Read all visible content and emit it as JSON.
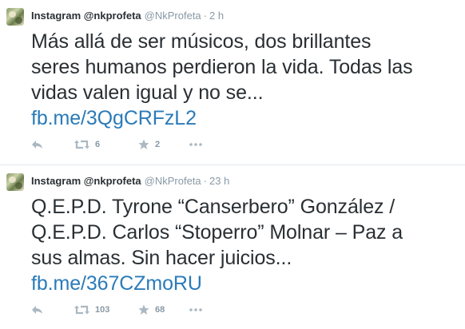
{
  "tweets": [
    {
      "display_name": "Instagram @nkprofeta",
      "screen_name": "@NkProfeta",
      "separator": "·",
      "time": "2 h",
      "lines": [
        "Más allá de ser músicos, dos brillantes",
        "seres humanos perdieron la vida. Todas las",
        "vidas valen igual y no se..."
      ],
      "link": "fb.me/3QgCRFzL2",
      "retweets": "6",
      "favorites": "2"
    },
    {
      "display_name": "Instagram @nkprofeta",
      "screen_name": "@NkProfeta",
      "separator": "·",
      "time": "23 h",
      "lines": [
        "Q.E.P.D. Tyrone “Canserbero” González /",
        "Q.E.P.D. Carlos “Stoperro” Molnar – Paz a",
        "sus almas. Sin hacer juicios..."
      ],
      "link": "fb.me/367CZmoRU",
      "retweets": "103",
      "favorites": "68"
    }
  ],
  "icons": {
    "reply": "reply-icon",
    "retweet": "retweet-icon",
    "favorite": "star-icon",
    "more": "more-icon"
  },
  "colors": {
    "link": "#2b7bb9",
    "muted": "#8899a6",
    "icon": "#aab8c2",
    "text": "#292f33"
  }
}
